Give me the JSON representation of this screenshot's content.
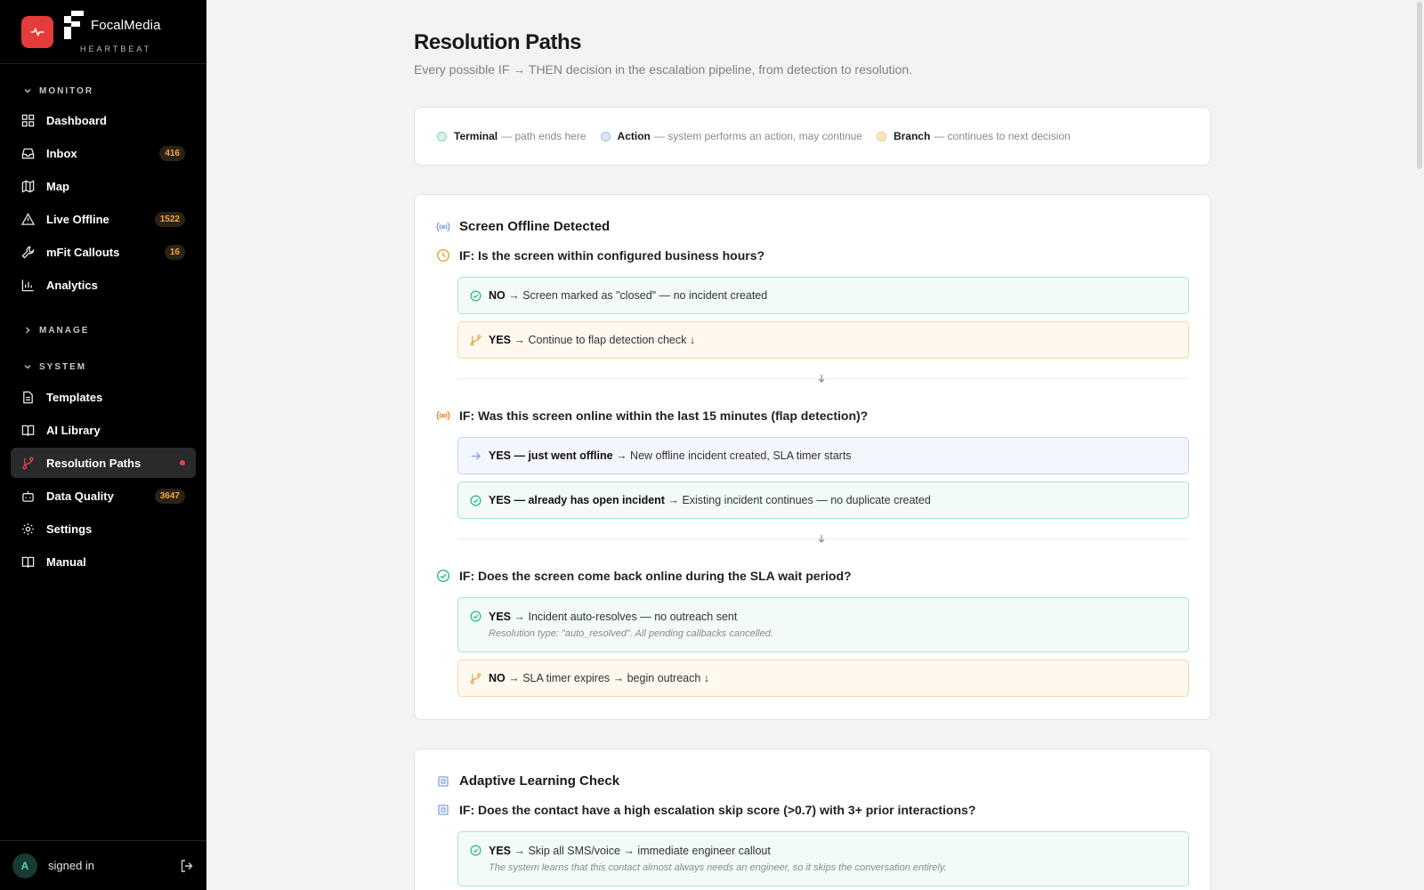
{
  "brand": {
    "name": "FocalMedia",
    "sub": "HEARTBEAT"
  },
  "nav": {
    "monitor_label": "MONITOR",
    "manage_label": "MANAGE",
    "system_label": "SYSTEM",
    "monitor_items": [
      {
        "label": "Dashboard",
        "icon": "dashboard-icon",
        "badge": ""
      },
      {
        "label": "Inbox",
        "icon": "inbox-icon",
        "badge": "416"
      },
      {
        "label": "Map",
        "icon": "map-icon",
        "badge": ""
      },
      {
        "label": "Live Offline",
        "icon": "warning-icon",
        "badge": "1522"
      },
      {
        "label": "mFit Callouts",
        "icon": "wrench-icon",
        "badge": "16"
      },
      {
        "label": "Analytics",
        "icon": "bar-chart-icon",
        "badge": ""
      }
    ],
    "system_items": [
      {
        "label": "Templates",
        "icon": "document-icon",
        "badge": ""
      },
      {
        "label": "AI Library",
        "icon": "book-icon",
        "badge": ""
      },
      {
        "label": "Resolution Paths",
        "icon": "branch-icon",
        "badge": ""
      },
      {
        "label": "Data Quality",
        "icon": "bot-icon",
        "badge": "3647"
      },
      {
        "label": "Settings",
        "icon": "gear-icon",
        "badge": ""
      },
      {
        "label": "Manual",
        "icon": "book-icon",
        "badge": ""
      }
    ],
    "user_initial": "A",
    "signed_in": "signed in"
  },
  "page": {
    "title": "Resolution Paths",
    "subtitle": "Every possible IF → THEN decision in the escalation pipeline, from detection to resolution."
  },
  "legend": {
    "terminal_label": "Terminal",
    "terminal_desc": "— path ends here",
    "action_label": "Action",
    "action_desc": "— system performs an action, may continue",
    "branch_label": "Branch",
    "branch_desc": "— continues to next decision",
    "colors": {
      "terminal": "#d6f3e9",
      "action": "#dbe6f8",
      "branch": "#fbe7c4"
    }
  },
  "section1": {
    "title": "Screen Offline Detected",
    "q1": "IF: Is the screen within configured business hours?",
    "q1_no_label": "NO",
    "q1_no_text": "→ Screen marked as \"closed\" — no incident created",
    "q1_yes_label": "YES",
    "q1_yes_text": "→ Continue to flap detection check ↓",
    "q2": "IF: Was this screen online within the last 15 minutes (flap detection)?",
    "q2_a_label": "YES — just went offline",
    "q2_a_text": "→ New offline incident created, SLA timer starts",
    "q2_b_label": "YES — already has open incident",
    "q2_b_text": "→ Existing incident continues — no duplicate created",
    "q3": "IF: Does the screen come back online during the SLA wait period?",
    "q3_yes_label": "YES",
    "q3_yes_text": "→ Incident auto-resolves — no outreach sent",
    "q3_yes_note": "Resolution type: \"auto_resolved\". All pending callbacks cancelled.",
    "q3_no_label": "NO",
    "q3_no_text": "→ SLA timer expires → begin outreach ↓"
  },
  "section2": {
    "title": "Adaptive Learning Check",
    "q1": "IF: Does the contact have a high escalation skip score (>0.7) with 3+ prior interactions?",
    "q1_yes_label": "YES",
    "q1_yes_text": "→ Skip all SMS/voice → immediate engineer callout",
    "q1_yes_note": "The system learns that this contact almost always needs an engineer, so it skips the conversation entirely."
  }
}
